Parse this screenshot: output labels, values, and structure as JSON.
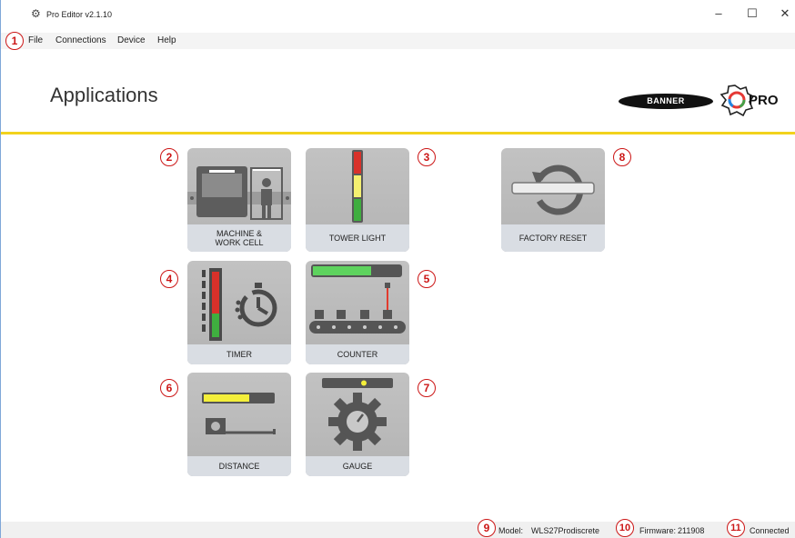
{
  "window": {
    "title": "Pro Editor v2.1.10",
    "minimize": "–",
    "maximize": "☐",
    "close": "✕"
  },
  "menu": {
    "items": [
      "File",
      "Connections",
      "Device",
      "Help"
    ]
  },
  "header": {
    "title": "Applications",
    "banner_logo": "BANNER",
    "pro_logo": "PRO"
  },
  "tiles": [
    {
      "label": "MACHINE &\nWORK CELL",
      "marker": "2",
      "icon": "machine-work-cell-icon"
    },
    {
      "label": "TOWER LIGHT",
      "marker": "3",
      "icon": "tower-light-icon"
    },
    {
      "label": "TIMER",
      "marker": "4",
      "icon": "timer-icon"
    },
    {
      "label": "COUNTER",
      "marker": "5",
      "icon": "counter-icon"
    },
    {
      "label": "DISTANCE",
      "marker": "6",
      "icon": "distance-icon"
    },
    {
      "label": "GAUGE",
      "marker": "7",
      "icon": "gauge-icon"
    },
    {
      "label": "FACTORY RESET",
      "marker": "8",
      "icon": "factory-reset-icon"
    }
  ],
  "markers": {
    "menu": "1",
    "model": "9",
    "firmware": "10",
    "status": "11"
  },
  "status": {
    "model_label": "Model:",
    "model_value": "WLS27Prodiscrete",
    "firmware_label": "Firmware:",
    "firmware_value": "211908",
    "connection": "Connected"
  },
  "colors": {
    "accent_yellow": "#f2d21c",
    "marker_red": "#cc1616",
    "tile_gray": "#b8b8b8",
    "label_band": "#d9dde3"
  }
}
